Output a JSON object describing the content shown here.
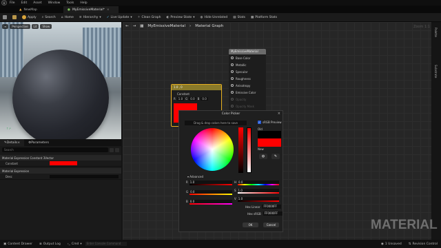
{
  "menu": [
    "File",
    "Edit",
    "Asset",
    "Window",
    "Tools",
    "Help"
  ],
  "tabs": [
    {
      "label": "NewMap"
    },
    {
      "label": "MyEmissiveMaterial*"
    }
  ],
  "toolbar": [
    "Apply",
    "Search",
    "Home",
    "Hierarchy",
    "Live Update",
    "Clean Graph",
    "Preview State",
    "Hide Unrelated",
    "Stats",
    "Platform Stats"
  ],
  "viewport": {
    "buttons": [
      "Perspective",
      "Lit",
      "Show"
    ]
  },
  "details": {
    "tabs": [
      "Details",
      "Parameters"
    ],
    "search_placeholder": "Search",
    "sections": [
      {
        "title": "Material Expression Constant 3Vector",
        "rows": [
          {
            "name": "Constant",
            "color": "#ff0000"
          }
        ]
      },
      {
        "title": "Material Expression",
        "rows": [
          {
            "name": "Desc"
          }
        ]
      }
    ]
  },
  "graph": {
    "breadcrumb": [
      "MyEmissiveMaterial",
      "Material Graph"
    ],
    "zoom": "Zoom 1:1",
    "material_node": {
      "title": "MyEmissiveMaterial",
      "pins": [
        {
          "label": "Base Color",
          "enabled": true
        },
        {
          "label": "Metallic",
          "enabled": true
        },
        {
          "label": "Specular",
          "enabled": true
        },
        {
          "label": "Roughness",
          "enabled": true
        },
        {
          "label": "Anisotropy",
          "enabled": true
        },
        {
          "label": "Emissive Color",
          "enabled": true
        },
        {
          "label": "Opacity",
          "enabled": false
        },
        {
          "label": "Opacity Mask",
          "enabled": false
        }
      ]
    },
    "constant_node": {
      "title": "1.0 , 0",
      "label": "Constant",
      "values": [
        "1.0",
        "0.0",
        "0.0"
      ],
      "color": "#ff0000"
    }
  },
  "right_tabs": [
    "Palette",
    "Substrate"
  ],
  "color_picker": {
    "title": "Color Picker",
    "drag_hint": "Drag & drop colors here to save",
    "srgb_label": "sRGB Preview",
    "old_label": "Old",
    "new_label": "New",
    "old_color": "#000000",
    "new_color": "#ff0000",
    "advanced_label": "Advanced",
    "rgb": [
      {
        "label": "R",
        "value": "1.0"
      },
      {
        "label": "G",
        "value": "0.0"
      },
      {
        "label": "B",
        "value": "0.0"
      }
    ],
    "hsv": [
      {
        "label": "H",
        "value": "0.0"
      },
      {
        "label": "S",
        "value": "1.0"
      },
      {
        "label": "V",
        "value": "1.0"
      }
    ],
    "hex_linear_label": "Hex Linear",
    "hex_linear": "FF0000FF",
    "hex_srgb_label": "Hex sRGB",
    "hex_srgb": "FF0000FF",
    "ok_label": "OK",
    "cancel_label": "Cancel"
  },
  "watermark": "MATERIAL",
  "statusbar": {
    "items": [
      "Content Drawer",
      "Output Log",
      "Cmd"
    ],
    "console_placeholder": "Enter Console Command",
    "unsaved": "1 Unsaved",
    "revision": "Revision Control"
  }
}
